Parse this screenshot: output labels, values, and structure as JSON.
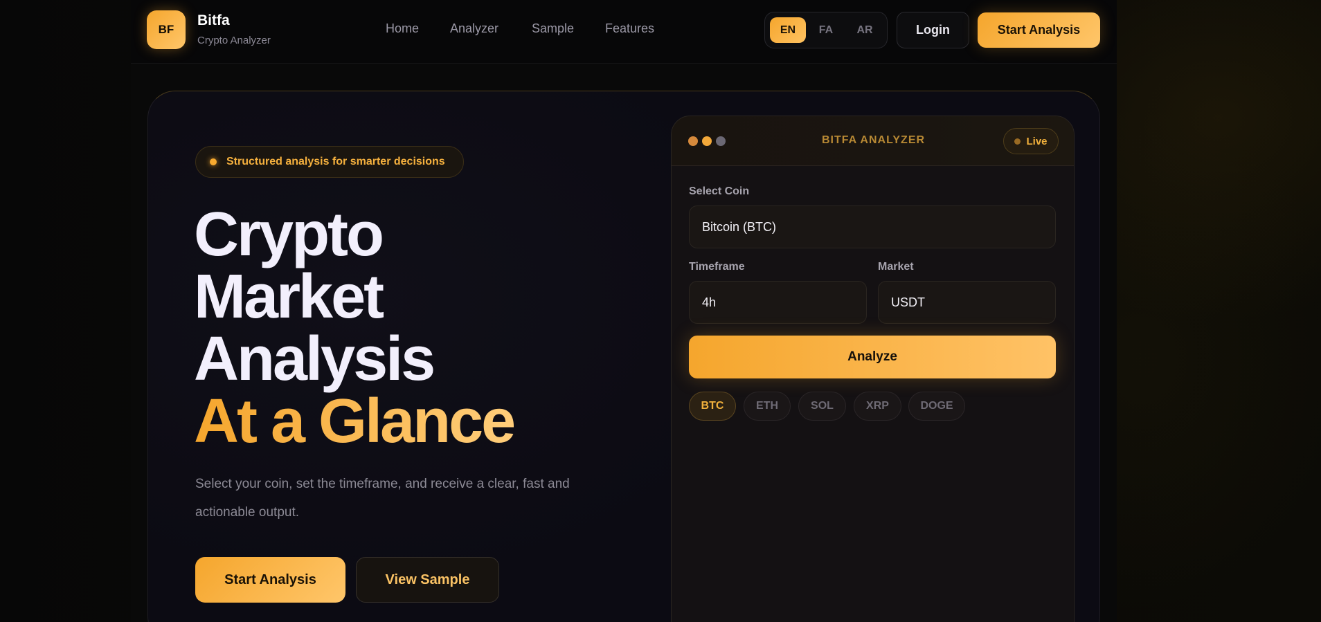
{
  "brand": {
    "badge": "BF",
    "name": "Bitfa",
    "subtitle": "Crypto Analyzer"
  },
  "nav": {
    "items": [
      {
        "label": "Home"
      },
      {
        "label": "Analyzer"
      },
      {
        "label": "Sample"
      },
      {
        "label": "Features"
      }
    ]
  },
  "languages": {
    "items": [
      "EN",
      "FA",
      "AR"
    ],
    "active": "EN"
  },
  "header_actions": {
    "login": "Login",
    "start": "Start Analysis"
  },
  "hero": {
    "pill_text": "Structured analysis for smarter decisions",
    "title_lines": [
      "Crypto",
      "Market",
      "Analysis"
    ],
    "title_accent": "At a Glance",
    "description": "Select your coin, set the timeframe, and receive a clear, fast and actionable output.",
    "cta_primary": "Start Analysis",
    "cta_secondary": "View Sample"
  },
  "analyzer": {
    "title": "BITFA ANALYZER",
    "status": "Live",
    "coin_label": "Select Coin",
    "coin_value": "Bitcoin (BTC)",
    "timeframe_label": "Timeframe",
    "timeframe_value": "4h",
    "market_label": "Market",
    "market_value": "USDT",
    "analyze_label": "Analyze",
    "quick_coins": [
      "BTC",
      "ETH",
      "SOL",
      "XRP",
      "DOGE"
    ],
    "selected_coin": "BTC"
  },
  "colors": {
    "accent": "#f5a62d",
    "accent_light": "#ffc66a",
    "background": "#050505",
    "card": "#0c0b13",
    "window_dot_1": "#d68a3c",
    "window_dot_2": "#f2a83a",
    "window_dot_3": "#6b6874"
  }
}
